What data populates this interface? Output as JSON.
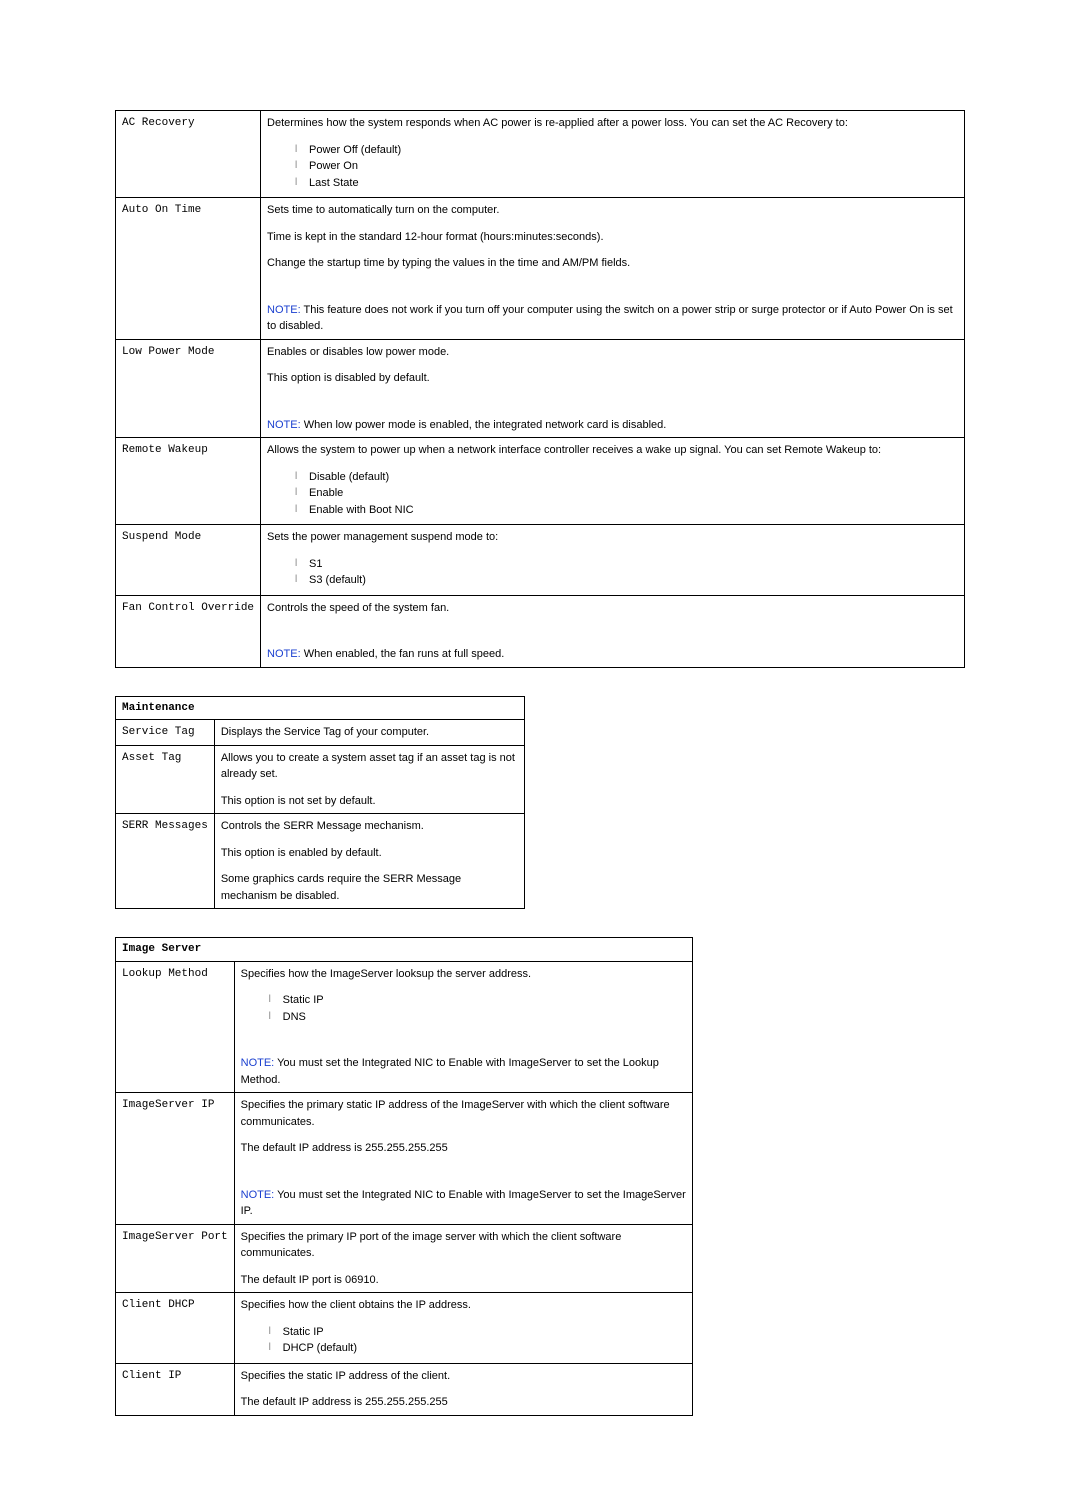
{
  "table1": {
    "rows": [
      {
        "label": "AC Recovery",
        "desc": "Determines how the system responds when AC power is re-applied after a power loss. You can set the AC Recovery to:",
        "options": [
          "Power Off (default)",
          "Power On",
          "Last State"
        ]
      },
      {
        "label": "Auto On Time",
        "desc1": "Sets time to automatically turn on the computer.",
        "desc2": "Time is kept in the standard 12-hour format (hours:minutes:seconds).",
        "desc3": "Change the startup time by typing the values in the time and AM/PM fields.",
        "note": "This feature does not work if you turn off your computer using the switch on a power strip or surge protector or if Auto Power On is set to disabled.",
        "note_label": "NOTE:"
      },
      {
        "label": "Low Power Mode",
        "desc1": "Enables or disables low power mode.",
        "desc2": "This option is disabled by default.",
        "note": "When low power mode is enabled, the integrated network card is disabled.",
        "note_label": "NOTE:"
      },
      {
        "label": "Remote Wakeup",
        "desc": "Allows the system to power up when a network interface controller receives a wake up signal. You can set Remote Wakeup to:",
        "options": [
          "Disable (default)",
          "Enable",
          "Enable with Boot NIC"
        ]
      },
      {
        "label": "Suspend Mode",
        "desc": "Sets the power management suspend mode to:",
        "options": [
          "S1",
          "S3 (default)"
        ]
      },
      {
        "label": "Fan Control Override",
        "desc1": "Controls the speed of the system fan.",
        "note": "When enabled, the fan runs at full speed.",
        "note_label": "NOTE:"
      }
    ]
  },
  "table2": {
    "header": "Maintenance",
    "rows": [
      {
        "label": "Service Tag",
        "desc": "Displays the Service Tag of your computer."
      },
      {
        "label": "Asset Tag",
        "desc1": "Allows you to create a system asset tag if an asset tag is not already set.",
        "desc2": "This option is not set by default."
      },
      {
        "label": "SERR Messages",
        "desc1": "Controls the SERR Message mechanism.",
        "desc2": "This option is enabled by default.",
        "desc3": "Some graphics cards require the SERR Message mechanism be disabled."
      }
    ]
  },
  "table3": {
    "header": "Image Server",
    "rows": [
      {
        "label": "Lookup Method",
        "desc": "Specifies how the ImageServer looksup the server address.",
        "options": [
          "Static IP",
          "DNS"
        ],
        "note": "You must set the Integrated NIC to Enable with ImageServer to set the Lookup Method.",
        "note_label": "NOTE:"
      },
      {
        "label": "ImageServer IP",
        "desc1": "Specifies the primary static IP address of the ImageServer with which the client software communicates.",
        "desc2": "The default IP address is 255.255.255.255",
        "note": "You must set the Integrated NIC to Enable with ImageServer to set the ImageServer IP.",
        "note_label": "NOTE:"
      },
      {
        "label": "ImageServer Port",
        "desc1": "Specifies the primary IP port of the image server with which the client software communicates.",
        "desc2": "The default IP port is 06910."
      },
      {
        "label": "Client DHCP",
        "desc": "Specifies how the client obtains the IP address.",
        "options": [
          "Static IP",
          "DHCP (default)"
        ]
      },
      {
        "label": "Client IP",
        "desc1": "Specifies the static IP address of the client.",
        "desc2": "The default IP address is 255.255.255.255"
      }
    ]
  }
}
